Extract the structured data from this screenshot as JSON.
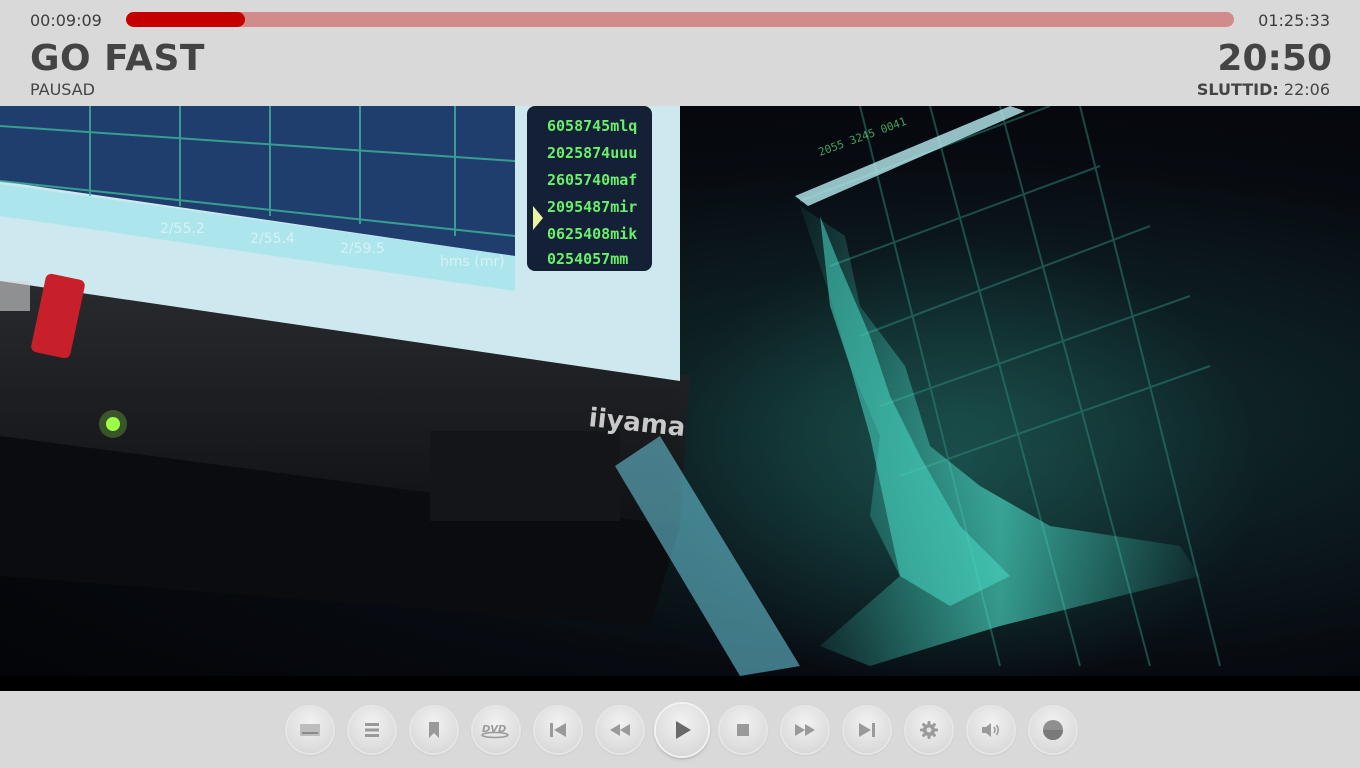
{
  "header": {
    "elapsed": "00:09:09",
    "total": "01:25:33",
    "progress_fraction": 0.107,
    "title": "GO FAST",
    "status": "PAUSAD",
    "clock": "20:50",
    "end_label": "SLUTTID:",
    "end_value": "22:06"
  },
  "video": {
    "screen_numbers": [
      "6058745mlq",
      "2025874uuu",
      "2605740maf",
      "2095487mir",
      "0625408mik",
      "0254057mm"
    ],
    "chart_labels": [
      "2/55.2",
      "2/55.4",
      "2/59.5",
      "hms (mr)"
    ],
    "brand": "iiyama"
  },
  "controls": [
    {
      "name": "subtitles-button",
      "icon": "subtitles-icon"
    },
    {
      "name": "menu-button",
      "icon": "list-icon"
    },
    {
      "name": "bookmark-button",
      "icon": "bookmark-icon"
    },
    {
      "name": "dvd-menu-button",
      "icon": "dvd-icon",
      "text": "DVD"
    },
    {
      "name": "skip-previous-button",
      "icon": "skip-previous-icon"
    },
    {
      "name": "rewind-button",
      "icon": "rewind-icon"
    },
    {
      "name": "play-button",
      "icon": "play-icon"
    },
    {
      "name": "stop-button",
      "icon": "stop-icon"
    },
    {
      "name": "fast-forward-button",
      "icon": "fast-forward-icon"
    },
    {
      "name": "skip-next-button",
      "icon": "skip-next-icon"
    },
    {
      "name": "settings-button",
      "icon": "gear-icon"
    },
    {
      "name": "volume-button",
      "icon": "volume-icon"
    },
    {
      "name": "record-button",
      "icon": "record-icon"
    }
  ],
  "colors": {
    "progress_fill": "#c40000",
    "progress_track": "#d28b8b",
    "bar_background": "#d9d9d9",
    "text": "#444444"
  }
}
